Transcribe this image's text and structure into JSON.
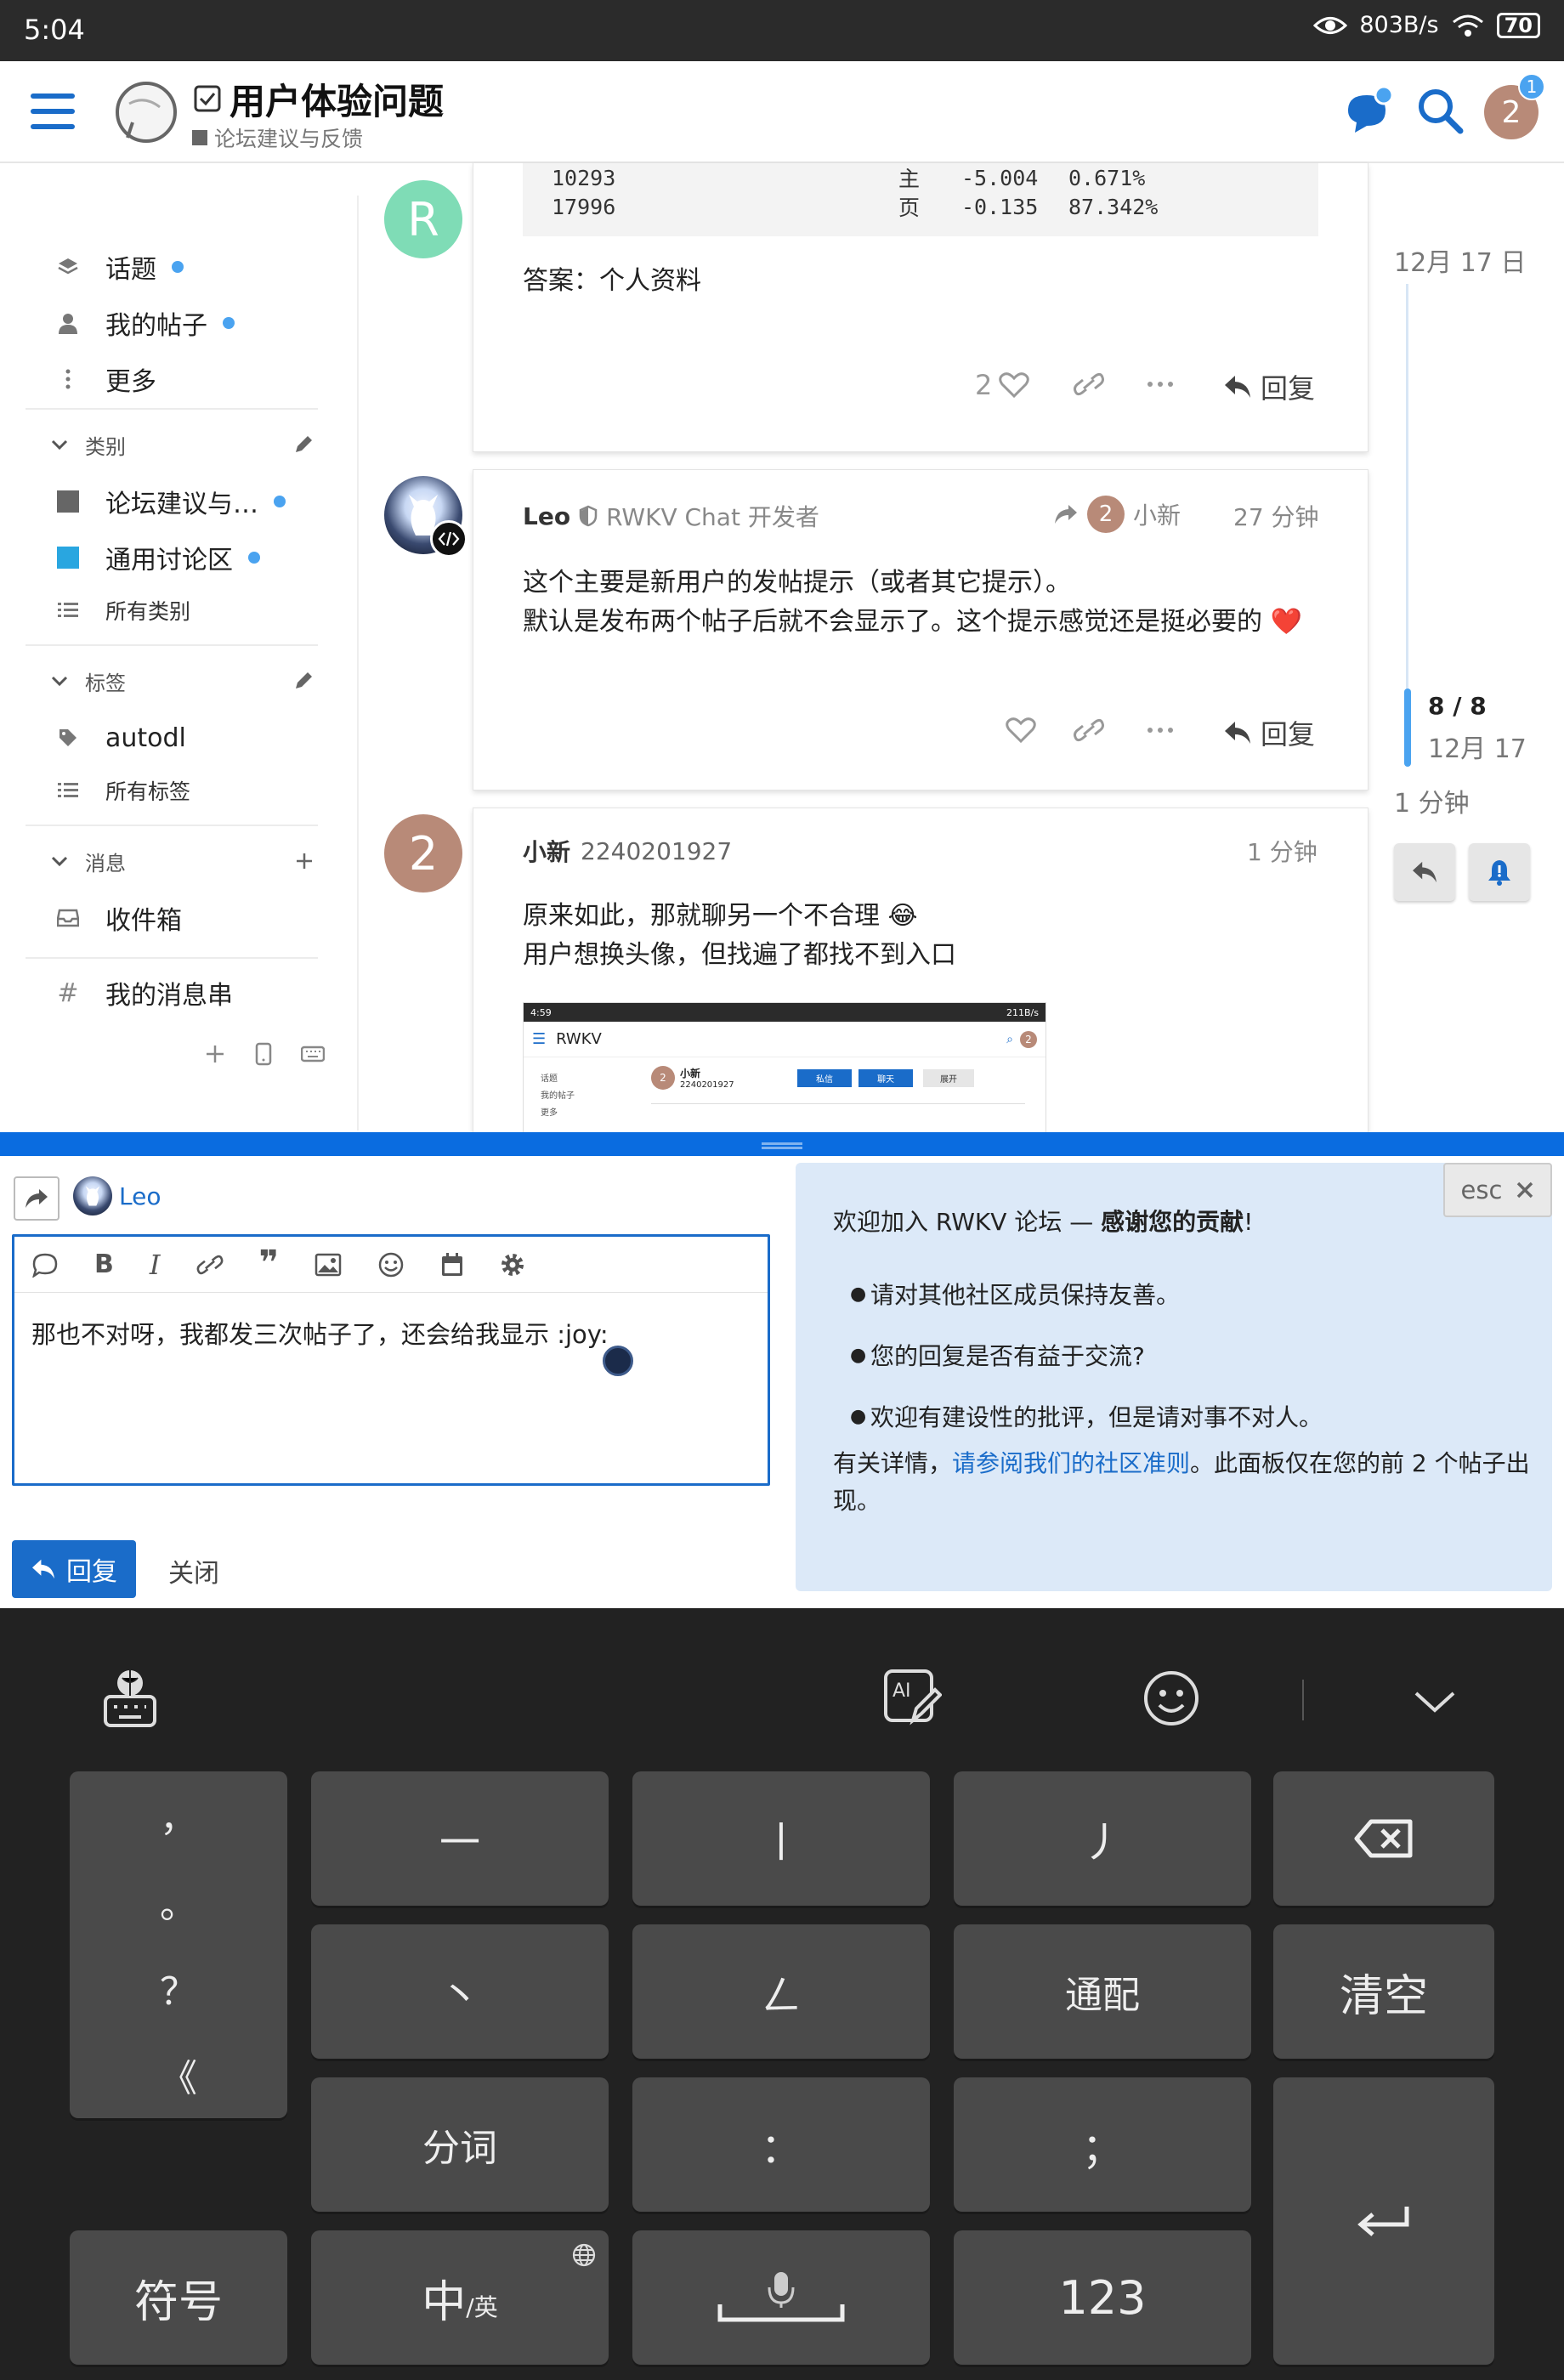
{
  "status_bar": {
    "time": "5:04",
    "net_speed": "803B/s",
    "battery": "70"
  },
  "header": {
    "topic_title": "用户体验问题",
    "category": "论坛建议与反馈",
    "avatar_letter": "2",
    "notification_count": "1",
    "colors": {
      "brand_blue": "#1a6cc9",
      "avatar_brown": "#b88a78"
    }
  },
  "sidebar": {
    "nav": [
      {
        "label": "话题",
        "icon": "layers-icon"
      },
      {
        "label": "我的帖子",
        "icon": "user-icon"
      },
      {
        "label": "更多",
        "icon": "ellipsis-icon"
      }
    ],
    "categories_title": "类别",
    "categories": [
      {
        "label": "论坛建议与…",
        "color": "#666666"
      },
      {
        "label": "通用讨论区",
        "color": "#29a6e0"
      }
    ],
    "all_categories": "所有类别",
    "tags_title": "标签",
    "tags": [
      {
        "label": "autodl"
      }
    ],
    "all_tags": "所有标签",
    "messages_title": "消息",
    "inbox": "收件箱",
    "my_threads": "我的消息串"
  },
  "posts": [
    {
      "avatar_letter": "R",
      "avatar_color": "#7fdcb6",
      "code_lines": [
        [
          "10293",
          "主",
          "-5.004",
          "0.671%"
        ],
        [
          "17996",
          "页",
          "-0.135",
          "87.342%"
        ]
      ],
      "text": "答案：个人资料",
      "likes": "2",
      "reply_label": "回复"
    },
    {
      "author": "Leo",
      "author_title": "RWKV Chat 开发者",
      "reply_to_letter": "2",
      "reply_to": "小新",
      "time": "27 分钟",
      "lines": [
        "这个主要是新用户的发帖提示（或者其它提示）。",
        "默认是发布两个帖子后就不会显示了。这个提示感觉还是挺必要的 ❤️"
      ],
      "reply_label": "回复"
    },
    {
      "avatar_letter": "2",
      "author": "小新",
      "author_id": "2240201927",
      "time": "1 分钟",
      "lines": [
        "原来如此，那就聊另一个不合理 😂",
        "用户想换头像，但找遍了都找不到入口"
      ],
      "thumb": {
        "time": "4:59",
        "speed": "211B/s",
        "title": "RWKV",
        "name": "小新",
        "id": "2240201927",
        "btn1": "私信",
        "btn2": "聊天",
        "btn3": "展开",
        "side1": "话题",
        "side2": "我的帖子",
        "side3": "更多",
        "avatar": "2"
      }
    }
  ],
  "timeline": {
    "date_top": "12月 17 日",
    "position": "8 / 8",
    "date_cur": "12月 17",
    "ago": "1 分钟",
    "progress": 1.0
  },
  "composer": {
    "reply_to_user": "Leo",
    "text": "那也不对呀，我都发三次帖子了，还会给我显示 :joy:",
    "submit_label": "回复",
    "close_label": "关闭",
    "esc_label": "esc"
  },
  "education": {
    "intro": "欢迎加入 RWKV 论坛 — ",
    "intro_bold": "感谢您的贡献",
    "intro_end": "!",
    "bullets": [
      "请对其他社区成员保持友善。",
      "您的回复是否有益于交流?",
      "欢迎有建设性的批评，但是请对事不对人。"
    ],
    "footer_pre": "有关详情，",
    "footer_link": "请参阅我们的社区准则",
    "footer_post": "。此面板仅在您的前 2 个帖子出现。"
  },
  "keyboard": {
    "punct_column": [
      "，",
      "。",
      "？",
      "《"
    ],
    "row1": [
      "一",
      "丨",
      "丿"
    ],
    "row2": [
      "丶",
      "ㄥ",
      "通配"
    ],
    "clear": "清空",
    "row3": [
      "分词",
      "：",
      "；"
    ],
    "symbols": "符号",
    "lang_main": "中",
    "lang_sub": "/英",
    "numbers": "123"
  }
}
